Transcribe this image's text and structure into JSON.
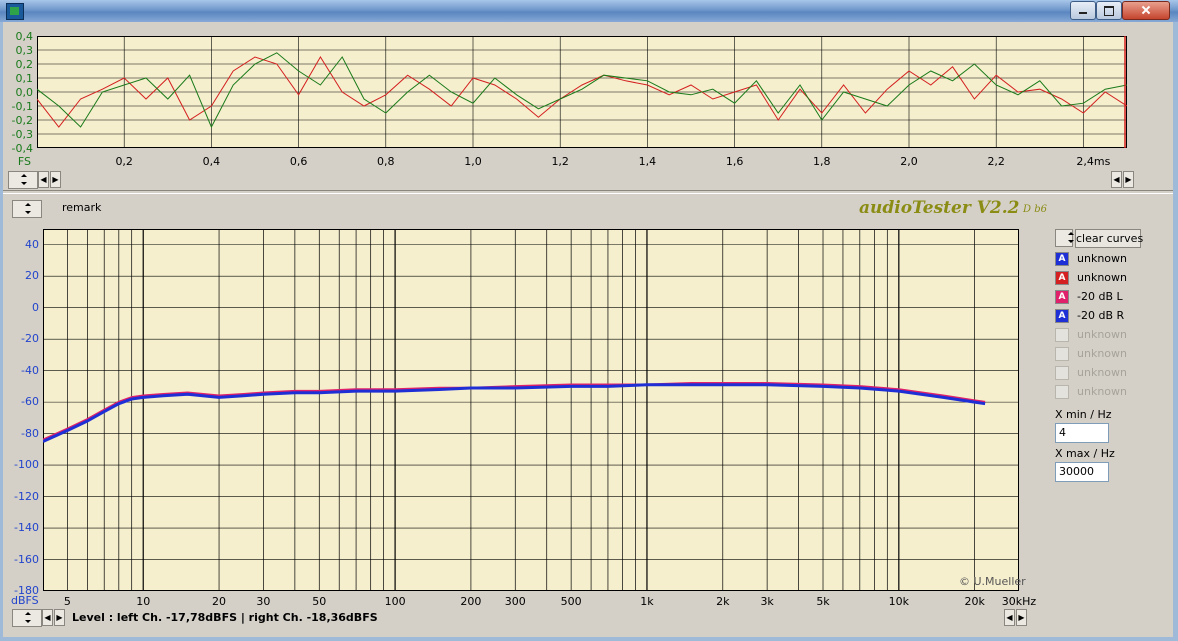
{
  "window": {
    "icon": "app-icon",
    "controls": [
      "minimize-icon",
      "maximize-icon",
      "close-icon"
    ]
  },
  "colors": {
    "plot_background": "#f5efcd",
    "left_channel": "#d42020",
    "right_channel": "#1a7a1a",
    "spectrum_left": "#e0206a",
    "spectrum_right": "#1f2fd6",
    "grid": "#000000",
    "brand": "#8b8c14"
  },
  "scope": {
    "y_ticks": [
      "0,4",
      "0,3",
      "0,2",
      "0,1",
      "0,0",
      "-0,1",
      "-0,2",
      "-0,3",
      "-0,4"
    ],
    "y_unit": "FS",
    "x_ticks": [
      "0,2",
      "0,4",
      "0,6",
      "0,8",
      "1,0",
      "1,2",
      "1,4",
      "1,6",
      "1,8",
      "2,0",
      "2,2",
      "2,4ms"
    ],
    "chart_data": {
      "type": "line",
      "x_unit": "ms",
      "ylim": [
        -0.4,
        0.4
      ],
      "xlim": [
        0,
        2.5
      ],
      "series": [
        {
          "color": "red",
          "x": [
            0,
            0.05,
            0.1,
            0.15,
            0.2,
            0.25,
            0.3,
            0.35,
            0.4,
            0.45,
            0.5,
            0.55,
            0.6,
            0.65,
            0.7,
            0.75,
            0.8,
            0.85,
            0.9,
            0.95,
            1.0,
            1.05,
            1.1,
            1.15,
            1.2,
            1.25,
            1.3,
            1.35,
            1.4,
            1.45,
            1.5,
            1.55,
            1.6,
            1.65,
            1.7,
            1.75,
            1.8,
            1.85,
            1.9,
            1.95,
            2.0,
            2.05,
            2.1,
            2.15,
            2.2,
            2.25,
            2.3,
            2.35,
            2.4,
            2.45,
            2.5
          ],
          "values": [
            -0.05,
            -0.25,
            -0.05,
            0.02,
            0.1,
            -0.05,
            0.1,
            -0.2,
            -0.1,
            0.15,
            0.25,
            0.2,
            -0.02,
            0.25,
            0.0,
            -0.1,
            -0.02,
            0.12,
            0.02,
            -0.1,
            0.1,
            0.05,
            -0.05,
            -0.18,
            -0.05,
            0.05,
            0.12,
            0.08,
            0.05,
            -0.02,
            0.05,
            -0.05,
            0.0,
            0.05,
            -0.2,
            0.02,
            -0.15,
            0.05,
            -0.15,
            0.02,
            0.15,
            0.05,
            0.18,
            -0.05,
            0.12,
            0.0,
            0.02,
            -0.05,
            -0.15,
            0.0,
            -0.1
          ]
        },
        {
          "color": "green",
          "x": [
            0,
            0.05,
            0.1,
            0.15,
            0.2,
            0.25,
            0.3,
            0.35,
            0.4,
            0.45,
            0.5,
            0.55,
            0.6,
            0.65,
            0.7,
            0.75,
            0.8,
            0.85,
            0.9,
            0.95,
            1.0,
            1.05,
            1.1,
            1.15,
            1.2,
            1.25,
            1.3,
            1.35,
            1.4,
            1.45,
            1.5,
            1.55,
            1.6,
            1.65,
            1.7,
            1.75,
            1.8,
            1.85,
            1.9,
            1.95,
            2.0,
            2.05,
            2.1,
            2.15,
            2.2,
            2.25,
            2.3,
            2.35,
            2.4,
            2.45,
            2.5
          ],
          "values": [
            0.02,
            -0.1,
            -0.25,
            0.0,
            0.05,
            0.1,
            -0.05,
            0.12,
            -0.25,
            0.05,
            0.2,
            0.28,
            0.15,
            0.05,
            0.25,
            -0.05,
            -0.15,
            0.0,
            0.12,
            0.0,
            -0.08,
            0.1,
            -0.02,
            -0.12,
            -0.05,
            0.02,
            0.12,
            0.1,
            0.08,
            0.0,
            -0.02,
            0.02,
            -0.08,
            0.08,
            -0.15,
            0.05,
            -0.2,
            0.0,
            -0.05,
            -0.1,
            0.05,
            0.15,
            0.08,
            0.2,
            0.05,
            -0.02,
            0.08,
            -0.1,
            -0.08,
            0.02,
            0.05
          ]
        }
      ]
    }
  },
  "spectrum": {
    "remark": "remark",
    "brand": "audioTester V2.2",
    "brand_version": "D b6",
    "copyright": "© U.Mueller",
    "y_unit": "dBFS",
    "y_ticks": [
      "40",
      "20",
      "0",
      "-20",
      "-40",
      "-60",
      "-80",
      "-100",
      "-120",
      "-140",
      "-160",
      "-180"
    ],
    "x_ticks": [
      "5",
      "10",
      "20",
      "30",
      "50",
      "100",
      "200",
      "300",
      "500",
      "1k",
      "2k",
      "3k",
      "5k",
      "10k",
      "20k",
      "30kHz"
    ],
    "chart_data": {
      "type": "line",
      "x_scale": "log",
      "xlim": [
        4,
        30000
      ],
      "ylim": [
        -180,
        50
      ],
      "series": [
        {
          "name": "-20 dB L",
          "color": "#e0206a",
          "x": [
            4,
            5,
            6,
            7,
            8,
            9,
            10,
            12,
            15,
            20,
            25,
            30,
            40,
            50,
            70,
            100,
            150,
            200,
            300,
            500,
            700,
            1000,
            1500,
            2000,
            3000,
            5000,
            7000,
            10000,
            15000,
            20000,
            22000
          ],
          "values": [
            -84,
            -77,
            -71,
            -65,
            -60,
            -57,
            -56,
            -55,
            -54,
            -56,
            -55,
            -54,
            -53,
            -53,
            -52,
            -52,
            -51,
            -51,
            -50,
            -49,
            -49,
            -49,
            -48,
            -48,
            -48,
            -49,
            -50,
            -52,
            -56,
            -59,
            -60
          ]
        },
        {
          "name": "-20 dB R",
          "color": "#1f2fd6",
          "x": [
            4,
            5,
            6,
            7,
            8,
            9,
            10,
            12,
            15,
            20,
            25,
            30,
            40,
            50,
            70,
            100,
            150,
            200,
            300,
            500,
            700,
            1000,
            1500,
            2000,
            3000,
            5000,
            7000,
            10000,
            15000,
            20000,
            22000
          ],
          "values": [
            -85,
            -78,
            -72,
            -66,
            -61,
            -58,
            -57,
            -56,
            -55,
            -57,
            -56,
            -55,
            -54,
            -54,
            -53,
            -53,
            -52,
            -51,
            -51,
            -50,
            -50,
            -49,
            -49,
            -49,
            -49,
            -50,
            -51,
            -53,
            -57,
            -60,
            -61
          ]
        }
      ]
    }
  },
  "legend": {
    "clear_button": "clear curves",
    "items": [
      {
        "label": "unknown",
        "mark": "A",
        "color": "#1f2fd6",
        "enabled": true
      },
      {
        "label": "unknown",
        "mark": "A",
        "color": "#d42020",
        "enabled": true
      },
      {
        "label": "-20 dB L",
        "mark": "A",
        "color": "#e0206a",
        "enabled": true
      },
      {
        "label": "-20 dB R",
        "mark": "A",
        "color": "#1f2fd6",
        "enabled": true
      },
      {
        "label": "unknown",
        "mark": "",
        "color": "#d4d0c8",
        "enabled": false
      },
      {
        "label": "unknown",
        "mark": "",
        "color": "#d4d0c8",
        "enabled": false
      },
      {
        "label": "unknown",
        "mark": "",
        "color": "#d4d0c8",
        "enabled": false
      },
      {
        "label": "unknown",
        "mark": "",
        "color": "#d4d0c8",
        "enabled": false
      }
    ]
  },
  "xrange": {
    "min_label": "X min / Hz",
    "min_value": "4",
    "max_label": "X max / Hz",
    "max_value": "30000"
  },
  "status": {
    "text": "Level :     left Ch. -17,78dBFS  |  right Ch. -18,36dBFS"
  }
}
